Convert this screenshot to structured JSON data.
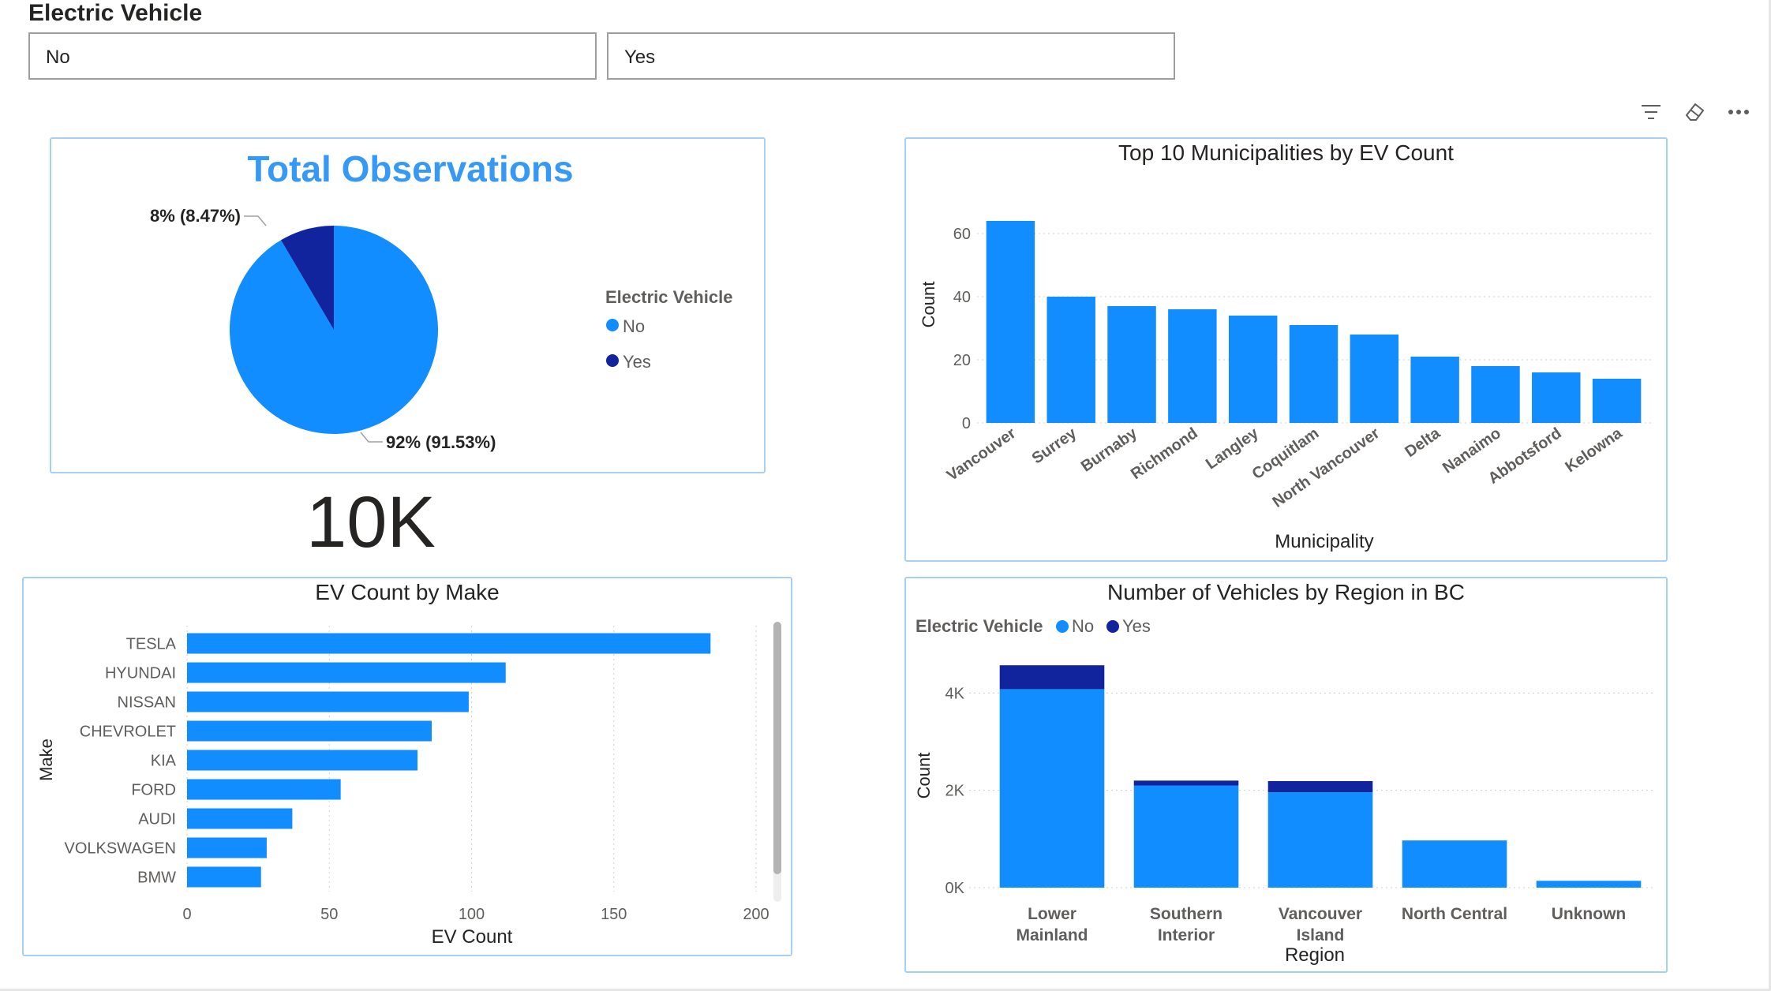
{
  "slicer": {
    "title": "Electric Vehicle",
    "options": [
      "No",
      "Yes"
    ]
  },
  "toolbar": {
    "icons": [
      "filter-icon",
      "eraser-icon",
      "more-options-icon"
    ]
  },
  "colors": {
    "no": "#118dff",
    "yes": "#12239e",
    "border": "#a9cff2"
  },
  "pie": {
    "title": "Total Observations",
    "legend_title": "Electric Vehicle",
    "legend": [
      "No",
      "Yes"
    ],
    "label_yes": "8% (8.47%)",
    "label_no": "92% (91.53%)"
  },
  "kpi": {
    "value": "10K"
  },
  "municipality_chart": {
    "title": "Top 10 Municipalities by EV Count",
    "xlabel": "Municipality",
    "ylabel": "Count"
  },
  "make_chart": {
    "title": "EV Count by Make",
    "xlabel": "EV Count",
    "ylabel": "Make"
  },
  "region_chart": {
    "title": "Number of Vehicles by Region in BC",
    "legend_title": "Electric Vehicle",
    "legend": [
      "No",
      "Yes"
    ],
    "xlabel": "Region",
    "ylabel": "Count"
  },
  "chart_data": [
    {
      "type": "pie",
      "title": "Total Observations",
      "categories": [
        "No",
        "Yes"
      ],
      "values": [
        91.53,
        8.47
      ],
      "legend_placement": "right"
    },
    {
      "type": "bar",
      "title": "Top 10 Municipalities by EV Count",
      "categories": [
        "Vancouver",
        "Surrey",
        "Burnaby",
        "Richmond",
        "Langley",
        "Coquitlam",
        "North Vancouver",
        "Delta",
        "Nanaimo",
        "Abbotsford",
        "Kelowna"
      ],
      "values": [
        64,
        40,
        37,
        36,
        34,
        31,
        28,
        21,
        18,
        16,
        14
      ],
      "xlabel": "Municipality",
      "ylabel": "Count",
      "ylim": [
        0,
        70
      ],
      "yticks": [
        0,
        20,
        40,
        60
      ],
      "grid": true
    },
    {
      "type": "bar",
      "orientation": "horizontal",
      "title": "EV Count by Make",
      "categories": [
        "TESLA",
        "HYUNDAI",
        "NISSAN",
        "CHEVROLET",
        "KIA",
        "FORD",
        "AUDI",
        "VOLKSWAGEN",
        "BMW"
      ],
      "values": [
        184,
        112,
        99,
        86,
        81,
        54,
        37,
        28,
        26
      ],
      "xlabel": "EV Count",
      "ylabel": "Make",
      "xlim": [
        0,
        200
      ],
      "xticks": [
        0,
        50,
        100,
        150,
        200
      ],
      "grid": true
    },
    {
      "type": "bar",
      "stacked": true,
      "title": "Number of Vehicles by Region in BC",
      "categories": [
        "Lower Mainland",
        "Southern Interior",
        "Vancouver Island",
        "North Central",
        "Unknown"
      ],
      "category_lines": [
        [
          "Lower",
          "Mainland"
        ],
        [
          "Southern",
          "Interior"
        ],
        [
          "Vancouver",
          "Island"
        ],
        [
          "North Central"
        ],
        [
          "Unknown"
        ]
      ],
      "series": [
        {
          "name": "No",
          "values": [
            4080,
            2100,
            1960,
            970,
            140
          ]
        },
        {
          "name": "Yes",
          "values": [
            490,
            100,
            230,
            0,
            0
          ]
        }
      ],
      "xlabel": "Region",
      "ylabel": "Count",
      "ylim": [
        0,
        4800
      ],
      "yticks": [
        0,
        2000,
        4000
      ],
      "ytick_labels": [
        "0K",
        "2K",
        "4K"
      ],
      "legend_placement": "top-left",
      "grid": true
    }
  ]
}
